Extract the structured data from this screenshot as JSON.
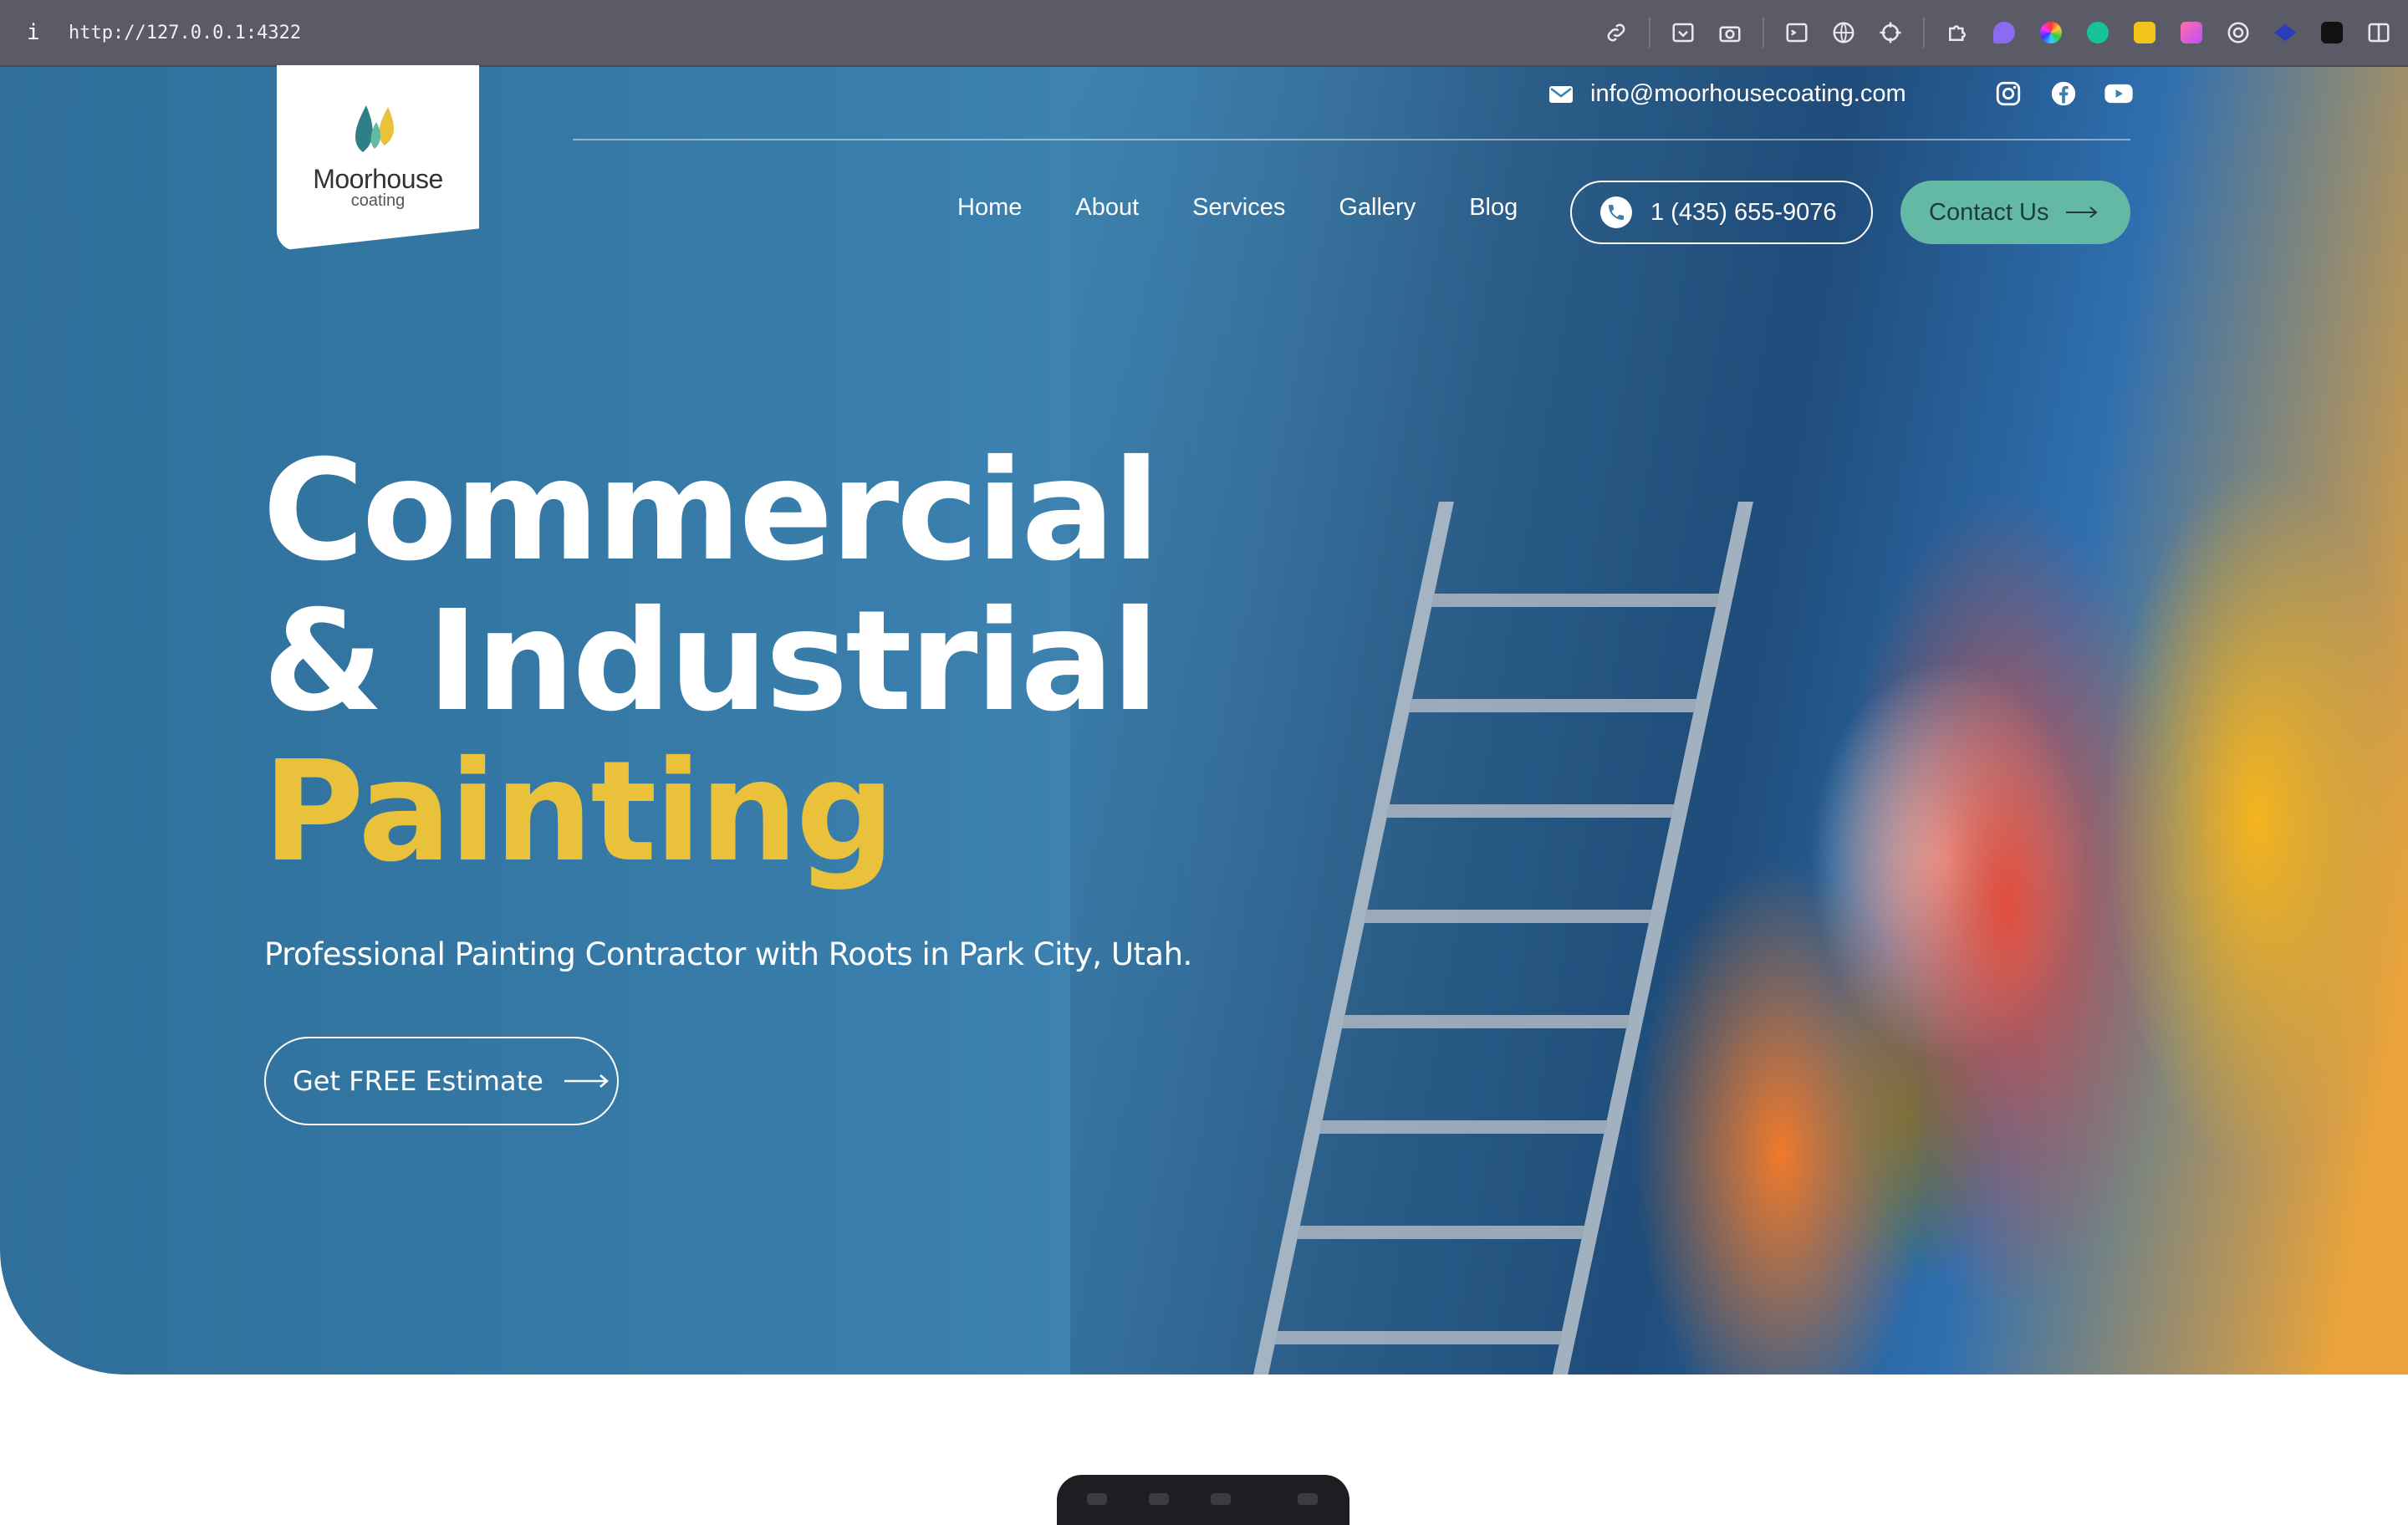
{
  "browser": {
    "info_glyph": "i",
    "url": "http://127.0.0.1:4322",
    "extensions": [
      "link-icon",
      "save-icon",
      "camera-icon",
      "terminal-icon",
      "globe-icon",
      "crosshair-icon",
      "puzzle-icon",
      "purple-ext-icon",
      "color-wheel-icon",
      "grammarly-icon",
      "yellow-ext-icon",
      "gradient-ext-icon",
      "target-icon",
      "hat-ext-icon",
      "font-ext-icon",
      "sidebar-icon"
    ]
  },
  "brand": {
    "name": "Moorhouse",
    "tagline": "coating"
  },
  "topbar": {
    "email": "info@moorhousecoating.com"
  },
  "nav": {
    "items": [
      {
        "label": "Home"
      },
      {
        "label": "About"
      },
      {
        "label": "Services"
      },
      {
        "label": "Gallery"
      },
      {
        "label": "Blog"
      }
    ],
    "phone": "1 (435) 655-9076",
    "contact": "Contact Us"
  },
  "hero": {
    "title_line1": "Commercial",
    "title_line2": "& Industrial",
    "title_highlight": "Painting",
    "subtitle": "Professional Painting Contractor with Roots in Park City, Utah.",
    "cta": "Get FREE Estimate"
  },
  "colors": {
    "hero_blue": "#3a7fad",
    "accent_yellow": "#e9c13b",
    "accent_teal": "#63b9a3",
    "browser_bar": "#5b5b68"
  }
}
